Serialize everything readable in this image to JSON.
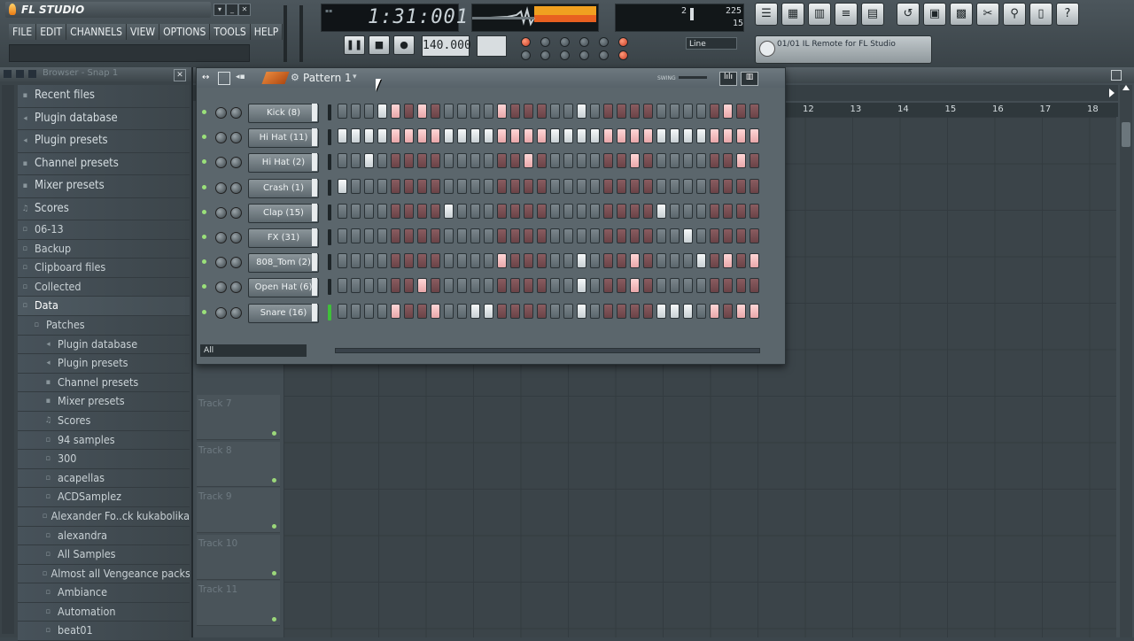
{
  "app": {
    "title": "FL STUDIO"
  },
  "menu": [
    "FILE",
    "EDIT",
    "CHANNELS",
    "VIEW",
    "OPTIONS",
    "TOOLS",
    "HELP"
  ],
  "transport": {
    "time": "1:31:001",
    "tempo_display": "140.000",
    "pause_icon": "pause-icon",
    "stop_icon": "stop-icon",
    "record_icon": "record-icon",
    "snap": "Line",
    "cpu_value": "2",
    "poly_value": "225",
    "voices": "15"
  },
  "hint": {
    "text": "01/01  IL Remote for FL Studio"
  },
  "toolbar_icons": [
    "playlist-icon",
    "piano-roll-icon",
    "step-seq-icon",
    "mixer-icon",
    "browser-icon",
    "undo-icon",
    "save-icon",
    "pack-icon",
    "cut-icon",
    "search-icon",
    "notes-icon",
    "help-icon"
  ],
  "browser": {
    "title": "Browser - Snap 1",
    "items": [
      {
        "label": "Recent files",
        "level": 0,
        "icon": "list-icon"
      },
      {
        "label": "Plugin database",
        "level": 0,
        "icon": "plug-icon"
      },
      {
        "label": "Plugin presets",
        "level": 0,
        "icon": "plug-icon"
      },
      {
        "label": "Channel presets",
        "level": 0,
        "icon": "channel-icon"
      },
      {
        "label": "Mixer presets",
        "level": 0,
        "icon": "mixer-icon"
      },
      {
        "label": "Scores",
        "level": 0,
        "icon": "note-icon"
      },
      {
        "label": "06-13",
        "level": 0,
        "icon": "folder-icon"
      },
      {
        "label": "Backup",
        "level": 0,
        "icon": "folder-icon"
      },
      {
        "label": "Clipboard files",
        "level": 0,
        "icon": "folder-icon"
      },
      {
        "label": "Collected",
        "level": 0,
        "icon": "folder-icon"
      },
      {
        "label": "Data",
        "level": 0,
        "icon": "folder-icon",
        "selected": true
      },
      {
        "label": "Patches",
        "level": 1,
        "icon": "folder-icon"
      },
      {
        "label": "Plugin database",
        "level": 2,
        "icon": "plug-icon"
      },
      {
        "label": "Plugin presets",
        "level": 2,
        "icon": "plug-icon"
      },
      {
        "label": "Channel presets",
        "level": 2,
        "icon": "channel-icon"
      },
      {
        "label": "Mixer presets",
        "level": 2,
        "icon": "mixer-icon"
      },
      {
        "label": "Scores",
        "level": 2,
        "icon": "note-icon"
      },
      {
        "label": "94 samples",
        "level": 2,
        "icon": "folder-icon"
      },
      {
        "label": "300",
        "level": 2,
        "icon": "folder-icon"
      },
      {
        "label": "acapellas",
        "level": 2,
        "icon": "folder-icon"
      },
      {
        "label": "ACDSamplez",
        "level": 2,
        "icon": "folder-icon"
      },
      {
        "label": "Alexander Fo..ck kukabolika",
        "level": 2,
        "icon": "folder-icon"
      },
      {
        "label": "alexandra",
        "level": 2,
        "icon": "folder-icon"
      },
      {
        "label": "All Samples",
        "level": 2,
        "icon": "folder-icon"
      },
      {
        "label": "Almost all Vengeance packs",
        "level": 2,
        "icon": "folder-icon"
      },
      {
        "label": "Ambiance",
        "level": 2,
        "icon": "folder-icon"
      },
      {
        "label": "Automation",
        "level": 2,
        "icon": "folder-icon"
      },
      {
        "label": "beat01",
        "level": 2,
        "icon": "folder-icon"
      }
    ]
  },
  "playlist": {
    "ruler": [
      "12",
      "13",
      "14",
      "15",
      "16",
      "17",
      "18"
    ],
    "tracks": [
      "Track 7",
      "Track 8",
      "Track 9",
      "Track 10",
      "Track 11"
    ]
  },
  "sequencer": {
    "pattern": "Pattern 1",
    "swing_label": "SWING",
    "filter": "All",
    "channels": [
      {
        "name": "Kick (8)",
        "steps": [
          0,
          0,
          0,
          1,
          1,
          0,
          1,
          0,
          0,
          0,
          0,
          0,
          1,
          0,
          0,
          0,
          0,
          0,
          1,
          0,
          0,
          0,
          0,
          0,
          0,
          0,
          0,
          0,
          0,
          1,
          0,
          0
        ]
      },
      {
        "name": "Hi Hat (11)",
        "steps": [
          1,
          1,
          1,
          1,
          1,
          1,
          1,
          1,
          1,
          1,
          1,
          1,
          1,
          1,
          1,
          1,
          1,
          1,
          1,
          1,
          1,
          1,
          1,
          1,
          1,
          1,
          1,
          1,
          1,
          1,
          1,
          1
        ]
      },
      {
        "name": "Hi Hat (2)",
        "steps": [
          0,
          0,
          1,
          0,
          0,
          0,
          0,
          0,
          0,
          0,
          0,
          0,
          0,
          0,
          1,
          0,
          0,
          0,
          0,
          0,
          0,
          0,
          1,
          0,
          0,
          0,
          0,
          0,
          0,
          0,
          1,
          0
        ]
      },
      {
        "name": "Crash (1)",
        "steps": [
          1,
          0,
          0,
          0,
          0,
          0,
          0,
          0,
          0,
          0,
          0,
          0,
          0,
          0,
          0,
          0,
          0,
          0,
          0,
          0,
          0,
          0,
          0,
          0,
          0,
          0,
          0,
          0,
          0,
          0,
          0,
          0
        ]
      },
      {
        "name": "Clap (15)",
        "steps": [
          0,
          0,
          0,
          0,
          0,
          0,
          0,
          0,
          1,
          0,
          0,
          0,
          0,
          0,
          0,
          0,
          0,
          0,
          0,
          0,
          0,
          0,
          0,
          0,
          1,
          0,
          0,
          0,
          0,
          0,
          0,
          0
        ]
      },
      {
        "name": "FX (31)",
        "steps": [
          0,
          0,
          0,
          0,
          0,
          0,
          0,
          0,
          0,
          0,
          0,
          0,
          0,
          0,
          0,
          0,
          0,
          0,
          0,
          0,
          0,
          0,
          0,
          0,
          0,
          0,
          1,
          0,
          0,
          0,
          0,
          0
        ]
      },
      {
        "name": "808_Tom (2)",
        "steps": [
          0,
          0,
          0,
          0,
          0,
          0,
          0,
          0,
          0,
          0,
          0,
          0,
          1,
          0,
          0,
          0,
          0,
          0,
          1,
          0,
          0,
          0,
          1,
          0,
          0,
          0,
          0,
          1,
          0,
          1,
          0,
          1
        ]
      },
      {
        "name": "Open Hat (6)",
        "steps": [
          0,
          0,
          0,
          0,
          0,
          0,
          1,
          0,
          0,
          0,
          0,
          0,
          0,
          0,
          0,
          0,
          0,
          0,
          1,
          0,
          0,
          0,
          1,
          0,
          0,
          0,
          0,
          0,
          0,
          0,
          0,
          0
        ]
      },
      {
        "name": "Snare (16)",
        "steps": [
          0,
          0,
          0,
          0,
          1,
          0,
          0,
          1,
          0,
          0,
          1,
          1,
          0,
          0,
          0,
          0,
          0,
          0,
          1,
          0,
          0,
          0,
          0,
          0,
          1,
          1,
          1,
          0,
          1,
          0,
          1,
          1
        ]
      }
    ]
  },
  "colors": {
    "accent": "#e8883c",
    "led": "#9ae07a",
    "step_on": "#f6f8f9",
    "step_on_alt": "#ffd6d6"
  }
}
